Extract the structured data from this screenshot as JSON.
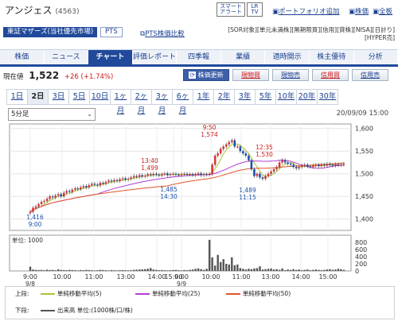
{
  "header": {
    "stock_name": "アンジェス",
    "stock_code": "(4563)",
    "smart_alert": [
      "スマート",
      "アラート"
    ],
    "lr_tv": [
      "LR",
      "TV"
    ],
    "portfolio_link": "ポートフォリオ追加",
    "stock_info_link": "株価",
    "board_link": "全板"
  },
  "market": {
    "market_label": "東証マザーズ(当社優先市場)",
    "pts_label": "PTS",
    "pts_compare_link": "PTS株価比較"
  },
  "tags": [
    "[SOR対象]",
    "[単元未満株]",
    "[無期限買]",
    "[信用]",
    "[貸株]",
    "[NISA]",
    "[日計り]",
    "[HYPER売]"
  ],
  "menu": [
    "株価",
    "ニュース",
    "チャート",
    "評価レポート",
    "四季報",
    "業績",
    "適時開示",
    "株主優待",
    "分析"
  ],
  "menu_active": "チャート",
  "quote": {
    "label": "現在値",
    "price": "1,522",
    "change": "+26 (+1.74%)",
    "update_button": "株価更新",
    "buy_spot": "現物買",
    "sell_spot": "現物売",
    "buy_margin": "信用買",
    "sell_margin": "信用売"
  },
  "period_tabs": [
    "1日",
    "2日",
    "3日",
    "5日",
    "10日",
    "1ヶ月",
    "2ヶ月",
    "3ヶ月",
    "6ヶ月",
    "1年",
    "2年",
    "3年",
    "5年",
    "10年",
    "20年",
    "30年"
  ],
  "period_active": "2日",
  "interval_select": "5分足",
  "timestamp": "20/09/09 15:00",
  "volume_unit": "単位: 1000",
  "legend": {
    "upper_label": "上段:",
    "lower_label": "下段:",
    "items": [
      {
        "label": "単純移動平均(5)",
        "color": "#a7c43a"
      },
      {
        "label": "単純移動平均(25)",
        "color": "#b23cd6"
      },
      {
        "label": "単純移動平均(50)",
        "color": "#e0552a"
      }
    ],
    "volume_label": "出来高 単位:(1000株/口/株)",
    "volume_color": "#555555"
  },
  "chart_data": {
    "type": "candlestick",
    "interval": "5分足",
    "period": "2日",
    "ylim": [
      1375,
      1610
    ],
    "y_ticks": [
      1400,
      1450,
      1500,
      1550,
      1600
    ],
    "x_tick_labels": [
      "9:00",
      "10:00",
      "11:00",
      "13:00",
      "14:00",
      "15:00",
      "9:00",
      "10:00",
      "11:00",
      "13:00",
      "14:00",
      "15:00"
    ],
    "date_labels": [
      "9/8",
      "9/9"
    ],
    "series_close": [
      1416,
      1425,
      1428,
      1433,
      1438,
      1440,
      1445,
      1450,
      1448,
      1452,
      1455,
      1450,
      1458,
      1462,
      1460,
      1465,
      1468,
      1466,
      1470,
      1473,
      1470,
      1475,
      1478,
      1476,
      1474,
      1480,
      1478,
      1482,
      1485,
      1483,
      1486,
      1484,
      1488,
      1490,
      1487,
      1489,
      1492,
      1495,
      1493,
      1497,
      1494,
      1496,
      1499,
      1497,
      1500,
      1498,
      1496,
      1499,
      1501,
      1497,
      1499,
      1500,
      1498,
      1497,
      1499,
      1500,
      1498,
      1499,
      1497,
      1499,
      1501,
      1497,
      1499,
      1498,
      1500,
      1520,
      1540,
      1545,
      1555,
      1560,
      1565,
      1570,
      1574,
      1560,
      1560,
      1550,
      1545,
      1540,
      1530,
      1510,
      1495,
      1500,
      1492,
      1489,
      1495,
      1500,
      1505,
      1510,
      1515,
      1525,
      1530,
      1525,
      1522,
      1520,
      1515,
      1512,
      1515,
      1518,
      1520,
      1516,
      1515,
      1518,
      1520,
      1517,
      1520,
      1518,
      1522,
      1520,
      1518,
      1521,
      1519,
      1520,
      1522
    ],
    "annotations": [
      {
        "text": "13:40",
        "value": "1,499",
        "kind": "high"
      },
      {
        "text": "9:50",
        "value": "1,574",
        "kind": "high"
      },
      {
        "text": "12:35",
        "value": "1,530",
        "kind": "high"
      },
      {
        "text": "1,416",
        "value": "9:00",
        "kind": "low"
      },
      {
        "text": "1,485",
        "value": "14:30",
        "kind": "low"
      },
      {
        "text": "1,489",
        "value": "11:15",
        "kind": "low"
      }
    ],
    "volume_ylim": [
      0,
      1000
    ],
    "volume_ticks": [
      0,
      200,
      400,
      600,
      800
    ],
    "volume": [
      120,
      40,
      30,
      25,
      30,
      20,
      35,
      25,
      30,
      20,
      45,
      30,
      25,
      20,
      30,
      25,
      20,
      15,
      25,
      20,
      30,
      25,
      20,
      15,
      20,
      30,
      25,
      20,
      15,
      25,
      20,
      15,
      20,
      25,
      20,
      15,
      20,
      30,
      35,
      40,
      45,
      50,
      60,
      80,
      40,
      30,
      20,
      25,
      20,
      15,
      20,
      25,
      30,
      20,
      15,
      25,
      20,
      30,
      40,
      60,
      70,
      50,
      30,
      60,
      870,
      380,
      150,
      450,
      250,
      330,
      200,
      180,
      380,
      160,
      180,
      80,
      60,
      40,
      60,
      50,
      70,
      80,
      130,
      40,
      50,
      60,
      70,
      40,
      50,
      30,
      70,
      20,
      40,
      30,
      50,
      30,
      40,
      20,
      30,
      40,
      20,
      30,
      40,
      30,
      20,
      30,
      40,
      50,
      30,
      40,
      60,
      50,
      30
    ]
  }
}
